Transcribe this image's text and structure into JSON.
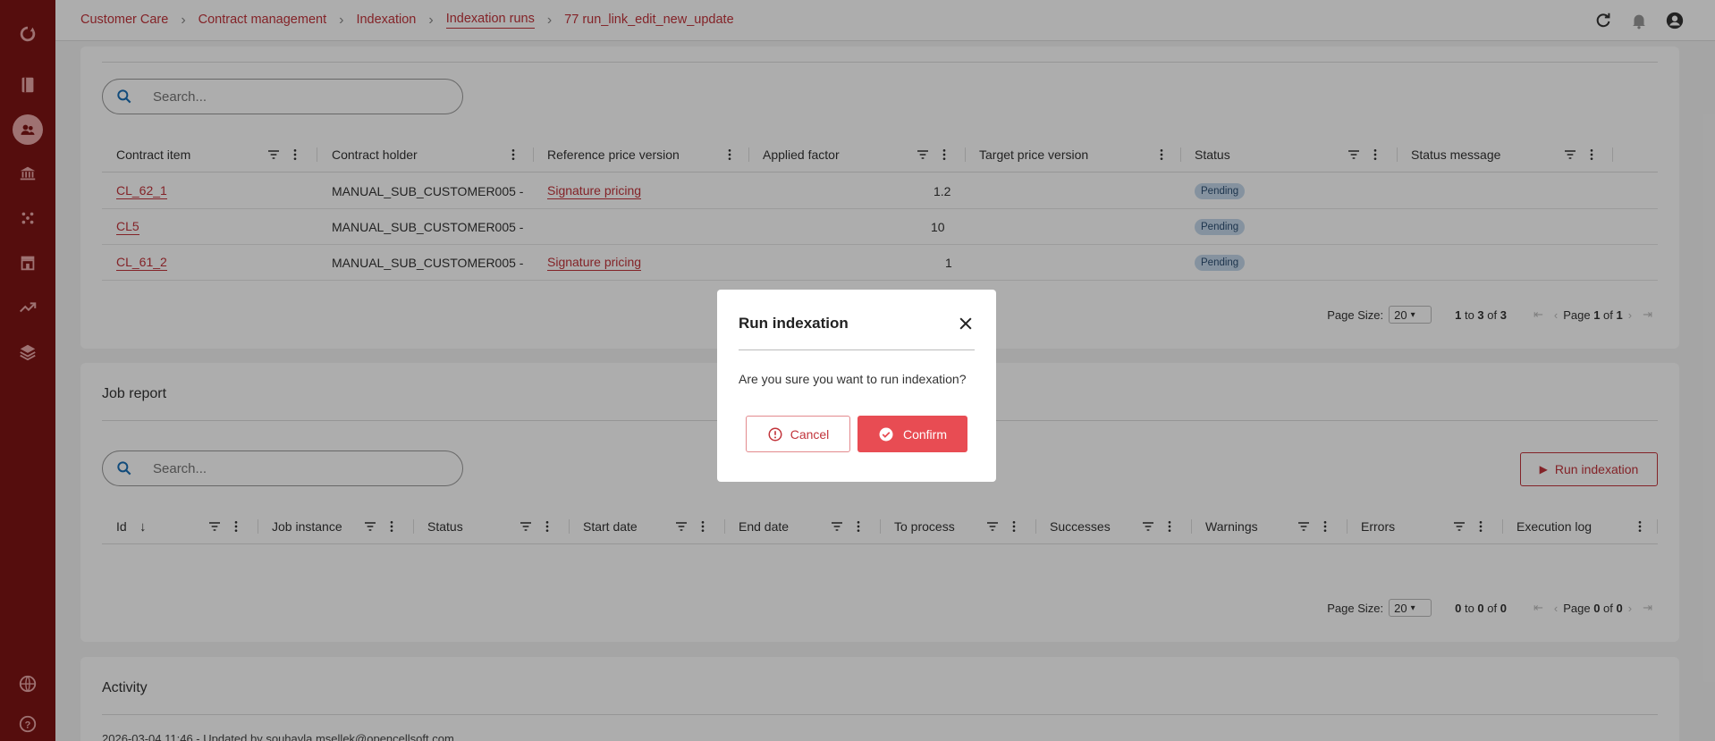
{
  "breadcrumb": {
    "items": [
      "Customer Care",
      "Contract management",
      "Indexation",
      "Indexation runs",
      "77 run_link_edit_new_update"
    ]
  },
  "contracts_section": {
    "search_placeholder": "Search...",
    "columns": [
      "Contract item",
      "Contract holder",
      "Reference price version",
      "Applied factor",
      "Target price version",
      "Status",
      "Status message"
    ],
    "rows": [
      {
        "contract_item": "CL_62_1",
        "holder": "MANUAL_SUB_CUSTOMER005 -",
        "ref_price": "Signature pricing",
        "factor": "1.2",
        "status": "Pending"
      },
      {
        "contract_item": "CL5",
        "holder": "MANUAL_SUB_CUSTOMER005 -",
        "ref_price": "",
        "factor": "10",
        "status": "Pending"
      },
      {
        "contract_item": "CL_61_2",
        "holder": "MANUAL_SUB_CUSTOMER005 -",
        "ref_price": "Signature pricing",
        "factor": "1",
        "status": "Pending"
      }
    ],
    "pager": {
      "page_size_label": "Page Size:",
      "page_size": "20",
      "from": "1",
      "to": "3",
      "of": "3",
      "page": "1",
      "pages": "1"
    }
  },
  "job_report": {
    "title": "Job report",
    "search_placeholder": "Search...",
    "run_button": "Run indexation",
    "columns": [
      "Id",
      "Job instance",
      "Status",
      "Start date",
      "End date",
      "To process",
      "Successes",
      "Warnings",
      "Errors",
      "Execution log"
    ],
    "pager": {
      "page_size_label": "Page Size:",
      "page_size": "20",
      "from": "0",
      "to": "0",
      "of": "0",
      "page": "0",
      "pages": "0"
    }
  },
  "activity": {
    "title": "Activity",
    "entry": "2026-03-04 11:46 - Updated by souhayla.msellek@opencellsoft.com"
  },
  "modal": {
    "title": "Run indexation",
    "message": "Are you sure you want to run indexation?",
    "cancel": "Cancel",
    "confirm": "Confirm"
  },
  "colors": {
    "brand": "#7e1414",
    "accent": "#c2343b",
    "confirm": "#e84c53",
    "badge": "#c5d8ea"
  }
}
